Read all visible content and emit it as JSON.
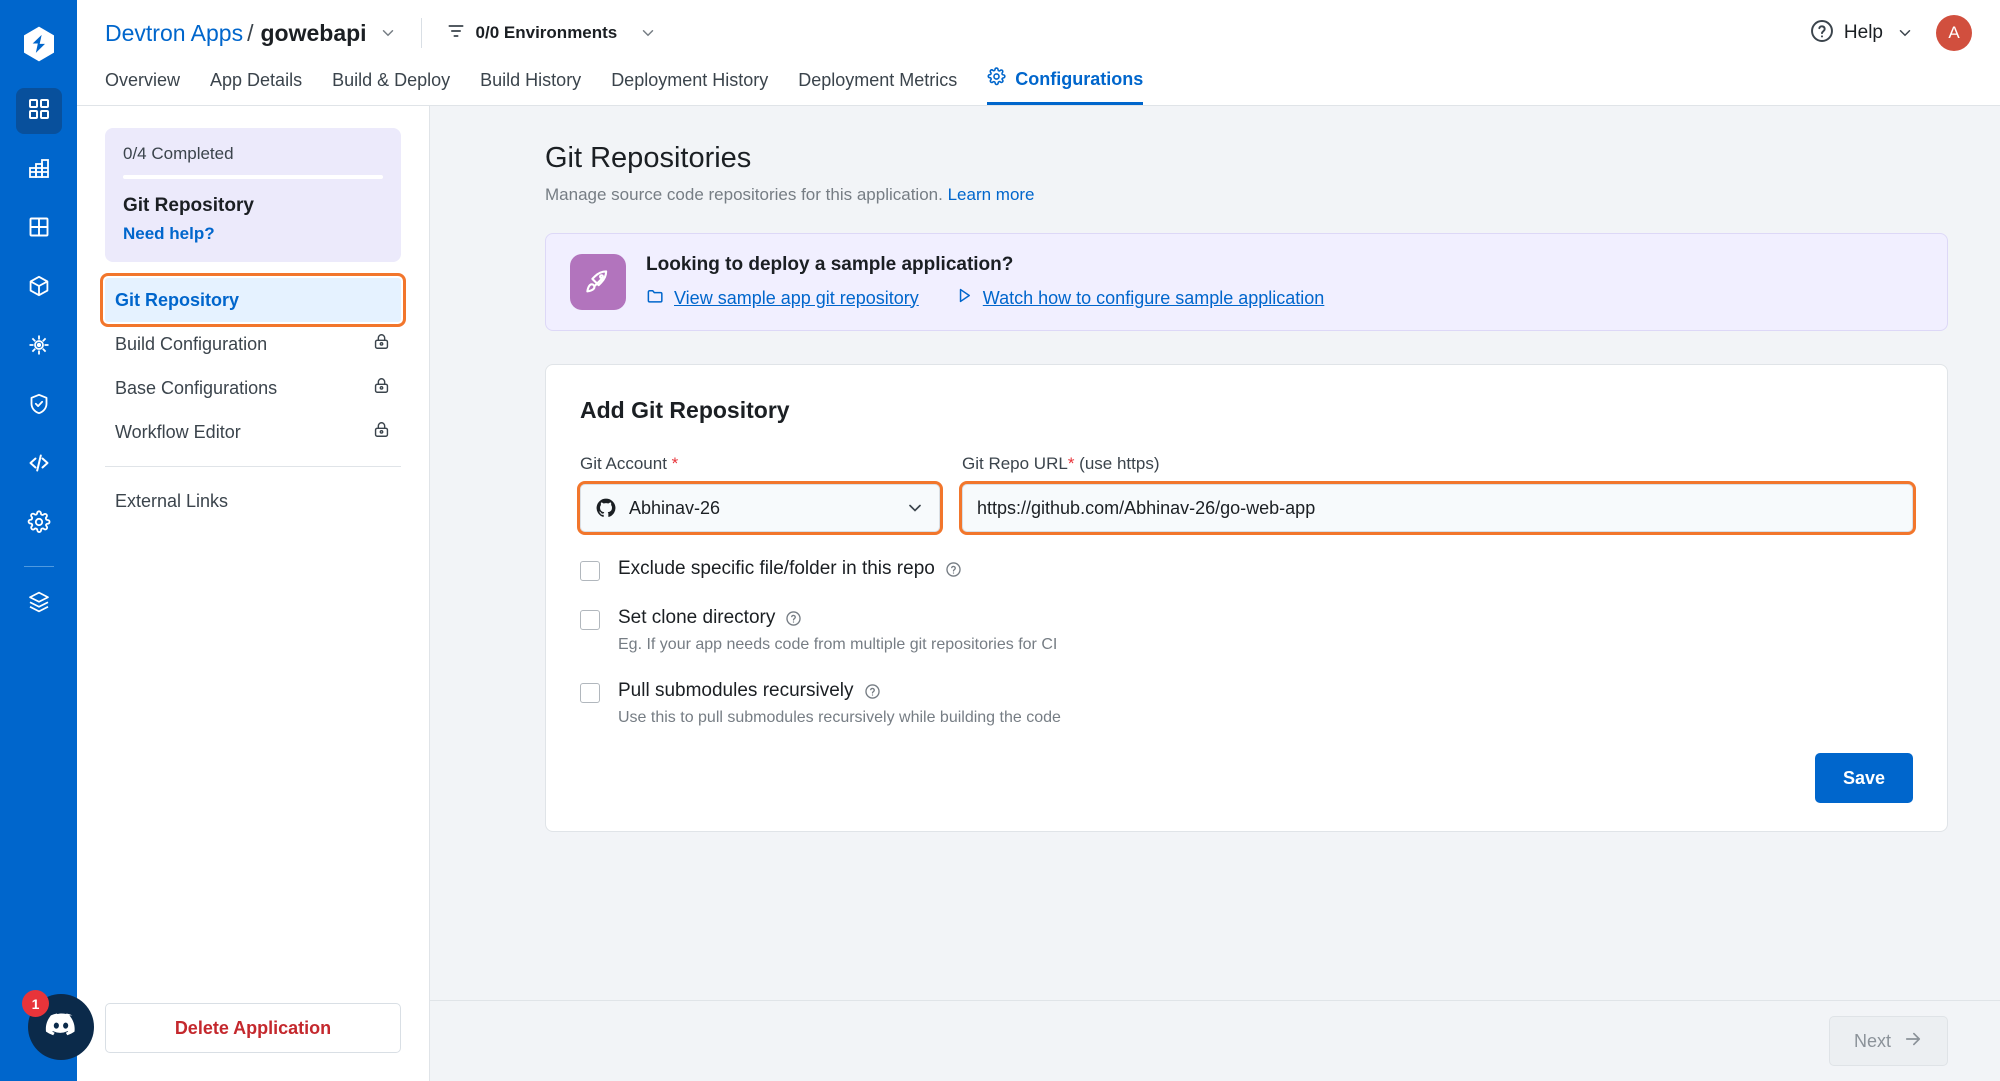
{
  "rail": {
    "logo_icon": "devtron-logo-icon",
    "items": [
      {
        "icon": "apps-grid-icon",
        "active": true
      },
      {
        "icon": "chart-bars-icon",
        "active": false
      },
      {
        "icon": "grid-table-icon",
        "active": false
      },
      {
        "icon": "cube-icon",
        "active": false
      },
      {
        "icon": "kubernetes-helm-icon",
        "active": false
      },
      {
        "icon": "shield-check-icon",
        "active": false
      },
      {
        "icon": "code-brackets-icon",
        "active": false
      },
      {
        "icon": "gear-icon",
        "active": false
      },
      {
        "icon": "stack-layers-icon",
        "active": false
      }
    ],
    "discord": {
      "icon": "discord-icon",
      "badge": "1"
    }
  },
  "header": {
    "breadcrumb_root": "Devtron Apps",
    "breadcrumb_separator": "/",
    "app_name": "gowebapi",
    "app_chevron_icon": "chevron-down-icon",
    "env_filter_icon": "filter-icon",
    "env_label": "0/0 Environments",
    "env_chevron_icon": "chevron-down-icon",
    "help_icon": "question-circle-icon",
    "help_label": "Help",
    "help_chevron_icon": "chevron-down-icon",
    "avatar_initial": "A"
  },
  "tabs": [
    {
      "label": "Overview",
      "active": false
    },
    {
      "label": "App Details",
      "active": false
    },
    {
      "label": "Build & Deploy",
      "active": false
    },
    {
      "label": "Build History",
      "active": false
    },
    {
      "label": "Deployment History",
      "active": false
    },
    {
      "label": "Deployment Metrics",
      "active": false
    },
    {
      "label": "Configurations",
      "active": true,
      "icon": "gear-icon"
    }
  ],
  "sidebar": {
    "progress": {
      "completed_text": "0/4 Completed",
      "percent": 0,
      "title": "Git Repository",
      "help_link": "Need help?"
    },
    "items": [
      {
        "label": "Git Repository",
        "active": true,
        "locked": false
      },
      {
        "label": "Build Configuration",
        "active": false,
        "locked": true
      },
      {
        "label": "Base Configurations",
        "active": false,
        "locked": true
      },
      {
        "label": "Workflow Editor",
        "active": false,
        "locked": true
      }
    ],
    "external_links_label": "External Links",
    "delete_button": "Delete Application"
  },
  "main": {
    "title": "Git Repositories",
    "subtitle": "Manage source code repositories for this application.",
    "learn_more": "Learn more",
    "banner": {
      "icon": "rocket-icon",
      "title": "Looking to deploy a sample application?",
      "link_repo_icon": "folder-icon",
      "link_repo": "View sample app git repository",
      "link_video_icon": "play-triangle-icon",
      "link_video": "Watch how to configure sample application"
    },
    "form": {
      "card_title": "Add Git Repository",
      "account_label": "Git Account",
      "account_required": "*",
      "account_icon": "github-icon",
      "account_value": "Abhinav-26",
      "account_caret_icon": "chevron-down-icon",
      "url_label": "Git Repo URL",
      "url_required": "*",
      "url_label_suffix": " (use https)",
      "url_value": "https://github.com/Abhinav-26/go-web-app",
      "checkboxes": [
        {
          "label": "Exclude specific file/folder in this repo",
          "help_icon": "question-circle-icon",
          "checked": false,
          "sub": ""
        },
        {
          "label": "Set clone directory",
          "help_icon": "question-circle-icon",
          "checked": false,
          "sub": "Eg. If your app needs code from multiple git repositories for CI"
        },
        {
          "label": "Pull submodules recursively",
          "help_icon": "question-circle-icon",
          "checked": false,
          "sub": "Use this to pull submodules recursively while building the code"
        }
      ],
      "save_button": "Save"
    }
  },
  "footer": {
    "next_label": "Next",
    "next_icon": "arrow-right-icon"
  },
  "colors": {
    "brand_blue": "#0066cc",
    "highlight_orange": "#f2762c",
    "danger_red": "#c4282d",
    "banner_purple": "#f1efff"
  }
}
